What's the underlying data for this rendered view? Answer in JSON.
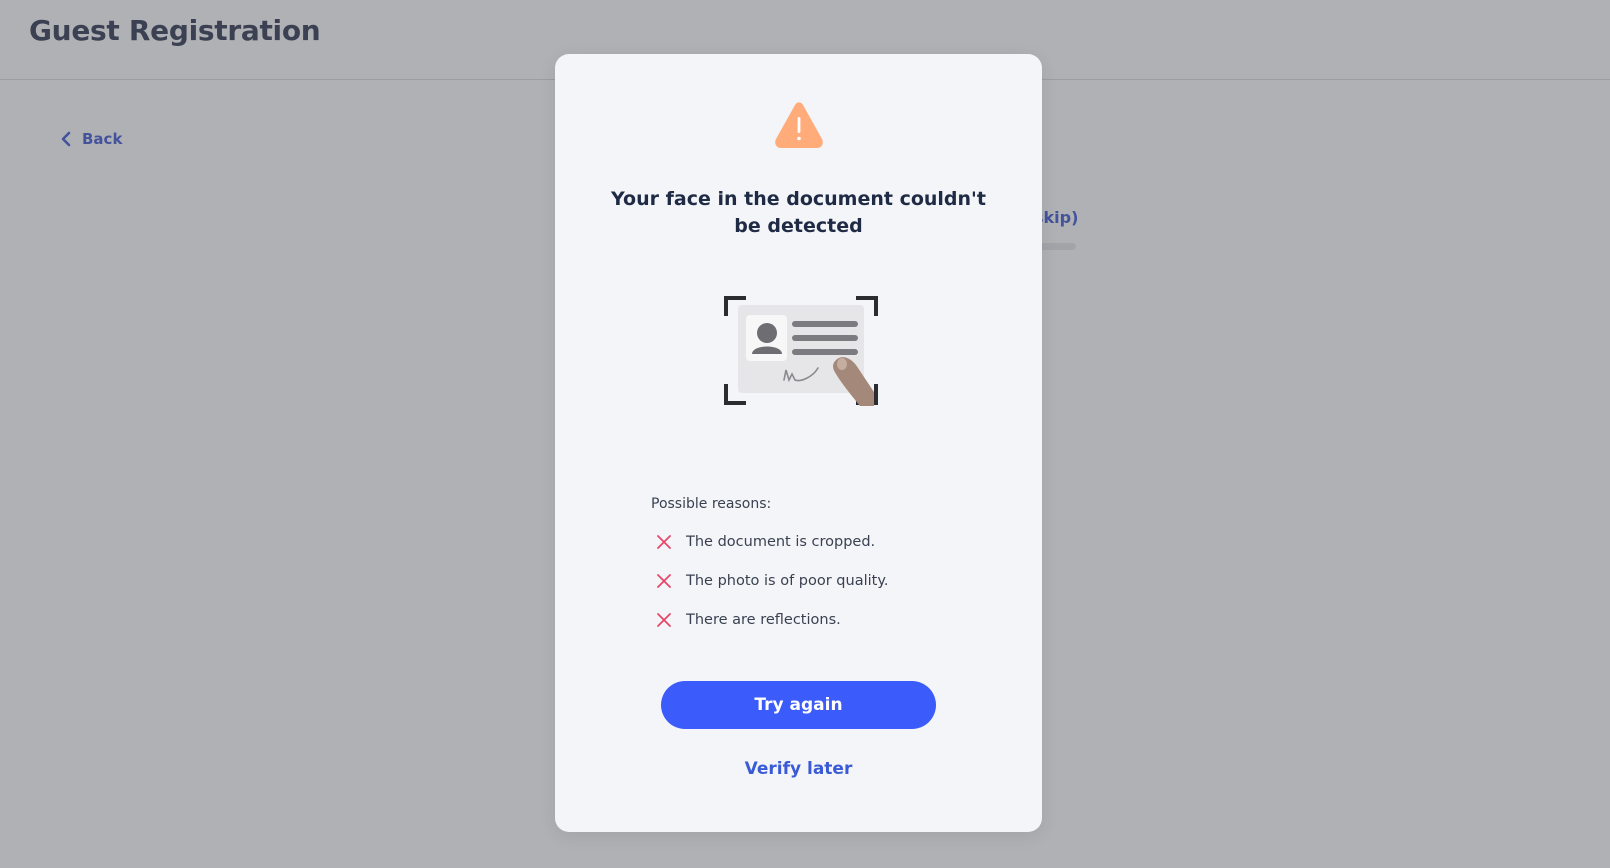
{
  "header": {
    "title": "Guest Registration"
  },
  "nav": {
    "back_label": "Back"
  },
  "background": {
    "skip_label_fragment": "skip)"
  },
  "modal": {
    "title": "Your face in the document couldn't be detected",
    "warning_icon": "warning-triangle-icon",
    "illustration": "id-card-scan-illustration",
    "reasons_title": "Possible reasons:",
    "reasons": [
      {
        "text": "The document is cropped.",
        "icon": "close-icon"
      },
      {
        "text": "The photo is of poor quality.",
        "icon": "close-icon"
      },
      {
        "text": "There are reflections.",
        "icon": "close-icon"
      }
    ],
    "primary_button": "Try again",
    "secondary_link": "Verify later"
  },
  "colors": {
    "accent": "#3b5bfb",
    "link": "#2f4bd1",
    "warning": "#ffab7a",
    "error": "#e8476a",
    "title": "#1f2a44",
    "modal_bg": "#f3f5f9"
  }
}
